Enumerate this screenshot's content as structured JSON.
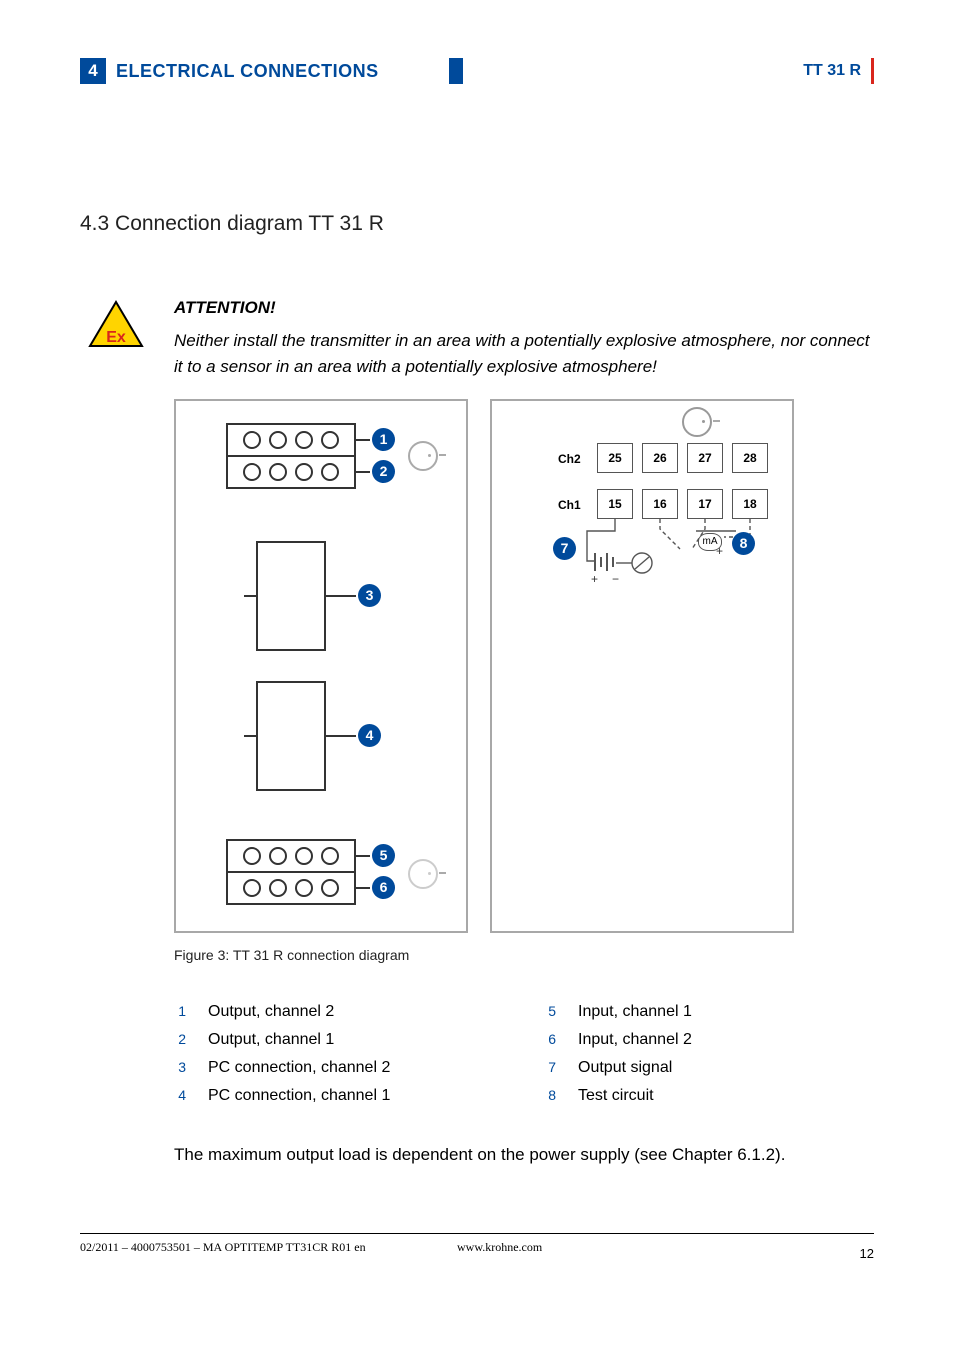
{
  "header": {
    "chapter_num": "4",
    "chapter_title": "ELECTRICAL CONNECTIONS",
    "device": "TT 31 R"
  },
  "section": {
    "title": "4.3  Connection diagram TT 31 R"
  },
  "attention": {
    "head": "ATTENTION!",
    "text": "Neither install the transmitter in an area with a potentially explosive atmosphere, nor connect it to a sensor in an area with a potentially explosive atmosphere!"
  },
  "diagram": {
    "callouts": [
      "1",
      "2",
      "3",
      "4",
      "5",
      "6",
      "7",
      "8"
    ],
    "b": {
      "row1_label": "Ch2",
      "row1_terms": [
        "25",
        "26",
        "27",
        "28"
      ],
      "row2_label": "Ch1",
      "row2_terms": [
        "15",
        "16",
        "17",
        "18"
      ],
      "ma_label": "mA"
    },
    "caption": "Figure 3: TT 31 R connection diagram"
  },
  "legend": [
    {
      "n": "1",
      "t": "Output, channel 2"
    },
    {
      "n": "2",
      "t": "Output, channel 1"
    },
    {
      "n": "3",
      "t": "PC connection, channel 2"
    },
    {
      "n": "4",
      "t": "PC connection, channel 1"
    },
    {
      "n": "5",
      "t": "Input, channel 1"
    },
    {
      "n": "6",
      "t": "Input, channel 2"
    },
    {
      "n": "7",
      "t": "Output signal"
    },
    {
      "n": "8",
      "t": "Test circuit"
    }
  ],
  "note": "The maximum output load is dependent on the power supply (see Chapter 6.1.2).",
  "footer": {
    "left": "02/2011 – 4000753501 – MA OPTITEMP TT31CR R01 en",
    "center": "www.krohne.com",
    "page": "12"
  }
}
